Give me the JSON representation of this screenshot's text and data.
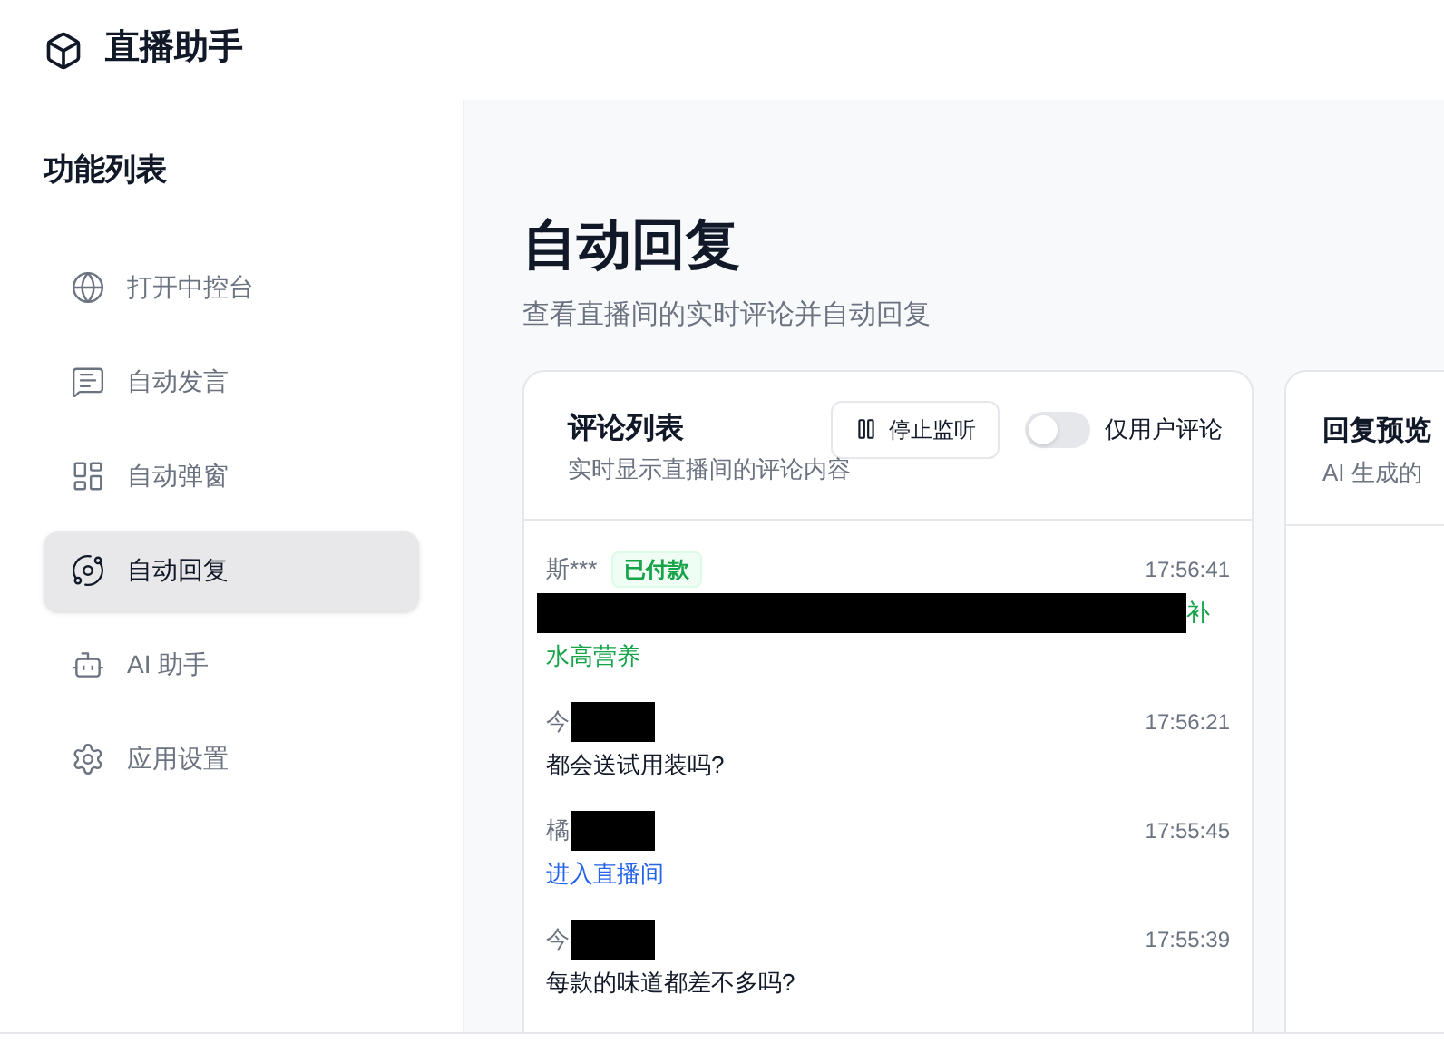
{
  "app": {
    "title": "直播助手"
  },
  "sidebar": {
    "heading": "功能列表",
    "items": [
      {
        "label": "打开中控台",
        "selected": false
      },
      {
        "label": "自动发言",
        "selected": false
      },
      {
        "label": "自动弹窗",
        "selected": false
      },
      {
        "label": "自动回复",
        "selected": true
      },
      {
        "label": "AI 助手",
        "selected": false
      },
      {
        "label": "应用设置",
        "selected": false
      }
    ]
  },
  "page": {
    "title": "自动回复",
    "subtitle": "查看直播间的实时评论并自动回复"
  },
  "comments_panel": {
    "title": "评论列表",
    "subtitle": "实时显示直播间的评论内容",
    "stop_button": "停止监听",
    "user_only_toggle": {
      "label": "仅用户评论",
      "on": false
    },
    "comments": [
      {
        "kind": "purchase",
        "user": "斯***",
        "badge": "已付款",
        "time": "17:56:41",
        "text_lines": [
          "补",
          "水高营养"
        ],
        "redacted": true
      },
      {
        "kind": "text",
        "user": "今",
        "time": "17:56:21",
        "text_lines": [
          "都会送试用装吗?"
        ],
        "redacted": true
      },
      {
        "kind": "enter",
        "user": "橘",
        "time": "17:55:45",
        "text_lines": [
          "进入直播间"
        ],
        "redacted": true
      },
      {
        "kind": "text",
        "user": "今",
        "time": "17:55:39",
        "text_lines": [
          "每款的味道都差不多吗?"
        ],
        "redacted": true
      }
    ]
  },
  "preview_panel": {
    "title": "回复预览",
    "subtitle": "AI 生成的"
  }
}
